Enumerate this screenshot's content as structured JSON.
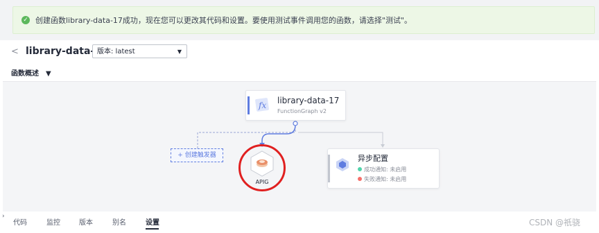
{
  "notice": {
    "message": "创建函数library-data-17成功，现在您可以更改其代码和设置。要使用测试事件调用您的函数，请选择\"测试\"。",
    "icon": "check-circle-icon"
  },
  "header": {
    "back_icon": "<",
    "title": "library-data-17",
    "version_label": "版本: latest",
    "version_caret": "▼"
  },
  "overview": {
    "label": "函数概述",
    "toggle": "▼"
  },
  "function_card": {
    "name": "library-data-17",
    "runtime": "FunctionGraph v2",
    "icon": "fx"
  },
  "trigger": {
    "create_label": "+ 创建触发器",
    "apig_label": "APIG"
  },
  "async_config": {
    "title": "异步配置",
    "success_label": "成功通知: 未启用",
    "failure_label": "失败通知: 未启用",
    "success_color": "#50d4ab",
    "failure_color": "#f66f6a"
  },
  "tabs": [
    {
      "label": "代码"
    },
    {
      "label": "监控"
    },
    {
      "label": "版本"
    },
    {
      "label": "别名"
    },
    {
      "label": "设置"
    }
  ],
  "active_tab": "设置",
  "watermark": "CSDN @祇骁",
  "colors": {
    "accent": "#5e7ce0",
    "highlight": "#e02020",
    "notice_bg": "#edf7e6"
  }
}
